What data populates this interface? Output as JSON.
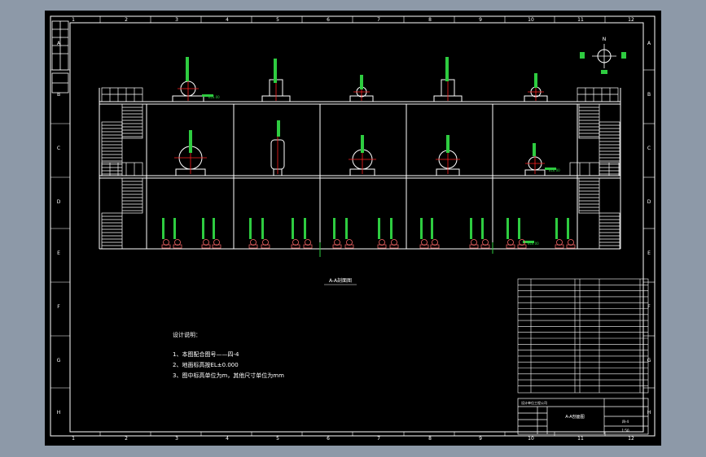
{
  "colors": {
    "viewport_bg": "#8d99a8",
    "sheet_bg": "#000000",
    "frame": "#ffffff",
    "dimension": "#2ecc40",
    "centerline": "#ff2020"
  },
  "border": {
    "columns": [
      "1",
      "2",
      "3",
      "4",
      "5",
      "6",
      "7",
      "8",
      "9",
      "10",
      "11",
      "12"
    ],
    "rows": [
      "A",
      "B",
      "C",
      "D",
      "E",
      "F",
      "G",
      "H"
    ]
  },
  "elevation_tag": "EL6.00",
  "view_title": "A-A剖面图",
  "notes": {
    "heading": "设计说明：",
    "lines": [
      "1、本图配合图号——四-4",
      "2、地面标高按EL±0.000",
      "3、图中标高单位为m，其他尺寸单位为mm"
    ]
  },
  "title_block": {
    "designer_line": "设计单位工程公司",
    "drawing_title": "A-A剖面图",
    "drawing_no": "四-4",
    "scale": "1:50"
  },
  "compass": {
    "north": "N"
  }
}
